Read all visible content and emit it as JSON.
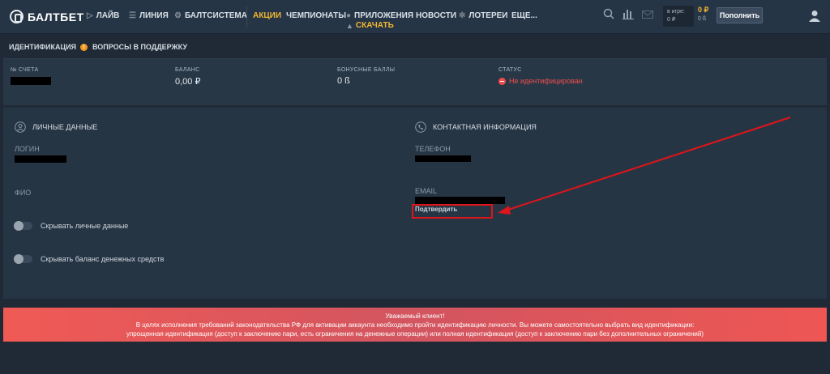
{
  "header": {
    "logo": "БАЛТБЕТ",
    "nav": [
      {
        "label": "ЛАЙВ",
        "icon": "live-icon"
      },
      {
        "label": "ЛИНИЯ",
        "icon": "line-icon"
      },
      {
        "label": "БАЛТСИСТЕМА",
        "icon": "system-icon"
      },
      {
        "label": "АКЦИИ",
        "icon": ""
      },
      {
        "label": "ЧЕМПИОНАТЫ",
        "icon": ""
      },
      {
        "label": "ПРИЛОЖЕНИЯ",
        "icon": "apple-icon"
      },
      {
        "label": "НОВОСТИ",
        "icon": ""
      },
      {
        "label": "ЛОТЕРЕИ",
        "icon": "lottery-icon"
      },
      {
        "label": "ЕЩЕ...",
        "icon": ""
      }
    ],
    "download": "СКАЧАТЬ",
    "in_game_label": "в игре:",
    "in_game_value": "0 ₽",
    "bonus_value": "0 ₽",
    "bonus_points": "0 ß",
    "topup": "Пополнить",
    "accent": "#f0b731"
  },
  "subtabs": {
    "identification": "ИДЕНТИФИКАЦИЯ",
    "identification_badge": "!",
    "support": "ВОПРОСЫ В ПОДДЕРЖКУ"
  },
  "account": {
    "number_label": "№ СЧЕТА",
    "balance_label": "БАЛАНС",
    "balance_value": "0,00 ₽",
    "bonus_label": "БОНУСНЫЕ БАЛЛЫ",
    "bonus_value": "0 ß",
    "status_label": "СТАТУС",
    "status_value": "Не идентифицирован",
    "status_color": "#ef4d4d"
  },
  "personal": {
    "title": "ЛИЧНЫЕ ДАННЫЕ",
    "login_label": "ЛОГИН",
    "fio_label": "ФИО",
    "toggle_hide_personal": "Скрывать личные данные",
    "toggle_hide_balance": "Скрывать баланс денежных средств"
  },
  "contact": {
    "title": "КОНТАКТНАЯ ИНФОРМАЦИЯ",
    "phone_label": "ТЕЛЕФОН",
    "email_label": "EMAIL",
    "confirm": "Подтвердить"
  },
  "banner": {
    "line1": "Уважаемый клиент!",
    "line2": "В целях исполнения требований законодательства РФ для активации аккаунта необходимо пройти идентификацию личности. Вы можете самостоятельно выбрать вид идентификации:",
    "line3": "упрощенная идентификация (доступ к заключению пари, есть ограничения на денежные операции) или полная идентификация (доступ к заключению пари без дополнительных ограничений)"
  }
}
